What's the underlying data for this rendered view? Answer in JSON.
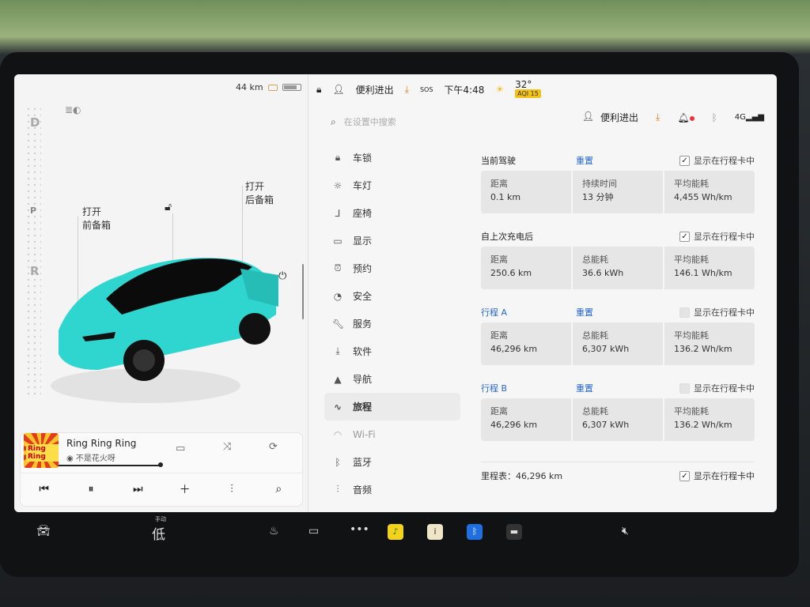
{
  "status": {
    "range": "44 km",
    "profile": "便利进出",
    "time": "下午4:48",
    "sos": "SOS",
    "temperature": "32°",
    "aqi": "AQI 15",
    "network": "4G"
  },
  "car": {
    "gears": [
      "D",
      "P",
      "R"
    ],
    "frunk_label_1": "打开",
    "frunk_label_2": "前备箱",
    "trunk_label_1": "打开",
    "trunk_label_2": "后备箱",
    "body_color": "#2fd6cf"
  },
  "music": {
    "title": "Ring Ring Ring",
    "artist": "不是花火呀",
    "album_art_text": "Ring Ring"
  },
  "search": {
    "placeholder": "在设置中搜索"
  },
  "profile_label": "便利进出",
  "menu": [
    {
      "label": "车锁",
      "icon": "lock-icon"
    },
    {
      "label": "车灯",
      "icon": "light-icon"
    },
    {
      "label": "座椅",
      "icon": "seat-icon"
    },
    {
      "label": "显示",
      "icon": "display-icon"
    },
    {
      "label": "预约",
      "icon": "clock-icon"
    },
    {
      "label": "安全",
      "icon": "shield-icon"
    },
    {
      "label": "服务",
      "icon": "wrench-icon"
    },
    {
      "label": "软件",
      "icon": "download-icon"
    },
    {
      "label": "导航",
      "icon": "navigation-icon"
    },
    {
      "label": "旅程",
      "icon": "trips-icon",
      "active": true
    },
    {
      "label": "Wi-Fi",
      "icon": "wifi-icon",
      "dim": true
    },
    {
      "label": "蓝牙",
      "icon": "bluetooth-icon"
    },
    {
      "label": "音频",
      "icon": "audio-icon"
    }
  ],
  "trips": {
    "current": {
      "name": "当前驾驶",
      "reset": "重置",
      "show_label": "显示在行程卡中",
      "checked": true,
      "stats": [
        {
          "label": "距离",
          "value": "0.1 km"
        },
        {
          "label": "持续时间",
          "value": "13 分钟"
        },
        {
          "label": "平均能耗",
          "value": "4,455 Wh/km"
        }
      ]
    },
    "since_charge": {
      "name": "自上次充电后",
      "show_label": "显示在行程卡中",
      "checked": true,
      "stats": [
        {
          "label": "距离",
          "value": "250.6 km"
        },
        {
          "label": "总能耗",
          "value": "36.6 kWh"
        },
        {
          "label": "平均能耗",
          "value": "146.1 Wh/km"
        }
      ]
    },
    "trip_a": {
      "name": "行程 A",
      "reset": "重置",
      "show_label": "显示在行程卡中",
      "checked": false,
      "stats": [
        {
          "label": "距离",
          "value": "46,296 km"
        },
        {
          "label": "总能耗",
          "value": "6,307 kWh"
        },
        {
          "label": "平均能耗",
          "value": "136.2 Wh/km"
        }
      ]
    },
    "trip_b": {
      "name": "行程 B",
      "reset": "重置",
      "show_label": "显示在行程卡中",
      "checked": false,
      "stats": [
        {
          "label": "距离",
          "value": "46,296 km"
        },
        {
          "label": "总能耗",
          "value": "6,307 kWh"
        },
        {
          "label": "平均能耗",
          "value": "136.2 Wh/km"
        }
      ]
    },
    "odometer": "里程表：46,296 km",
    "odometer_show_label": "显示在行程卡中"
  },
  "bottom_bar": {
    "fan_mode": "手动",
    "fan_level": "低"
  }
}
